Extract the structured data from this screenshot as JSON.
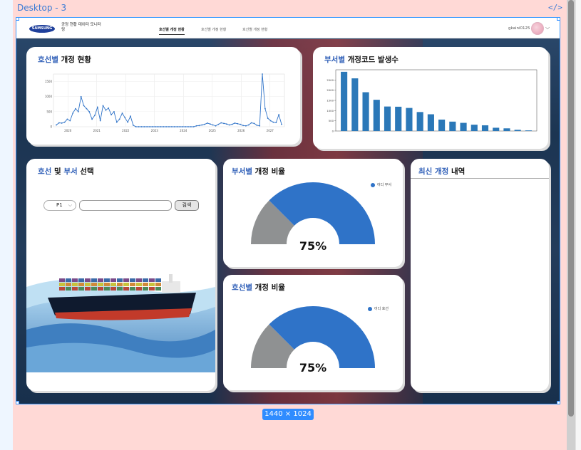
{
  "canvas": {
    "frame_label": "Desktop - 3",
    "code_icon": "</>",
    "size_badge": "1440 × 1024"
  },
  "header": {
    "logo_text": "SAMSUNG",
    "app_name": "공정 현황 데이터 모니터링",
    "nav": [
      "호선별 개정 현황",
      "호선별 개정 현황",
      "호선별 개정 현황"
    ],
    "user": "gkaini0125"
  },
  "cards": {
    "ship_revision": {
      "title_accent": "호선별",
      "title_rest": " 개정 현황"
    },
    "dept_code": {
      "title_accent": "부서별",
      "title_rest": " 개정코드 발생수"
    },
    "selector": {
      "title_a1": "호선",
      "title_mid": " 및 ",
      "title_a2": "부서",
      "title_rest": " 선택",
      "select_value": "P1",
      "search_label": "검색"
    },
    "dept_ratio": {
      "title_accent": "부서별",
      "title_rest": " 개정 비율",
      "legend": "어디 부서",
      "percent": "75%"
    },
    "ship_ratio": {
      "title_accent": "호선별",
      "title_rest": " 개정 비율",
      "legend": "어디 호선",
      "percent": "75%"
    },
    "recent": {
      "title_accent": "최신 개정",
      "title_rest": " 내역"
    }
  },
  "colors": {
    "accent": "#2f5fb8",
    "series": "#2f73c8",
    "gauge_gray": "#8f9192",
    "bar": "#2b78b8"
  },
  "chart_data": [
    {
      "type": "line",
      "name": "ship-revision-timeline",
      "x_ticks": [
        "2020",
        "2021",
        "2022",
        "2023",
        "2024",
        "2025",
        "2026",
        "2027"
      ],
      "ylim": [
        0,
        1750
      ],
      "y_ticks": [
        0,
        500,
        1000,
        1500
      ],
      "values": [
        60,
        130,
        120,
        150,
        250,
        200,
        450,
        600,
        500,
        1000,
        700,
        600,
        500,
        250,
        380,
        650,
        200,
        700,
        550,
        620,
        400,
        500,
        150,
        250,
        450,
        300,
        150,
        350,
        50,
        0,
        0,
        0,
        0,
        0,
        0,
        0,
        0,
        0,
        0,
        0,
        0,
        0,
        0,
        0,
        0,
        0,
        0,
        0,
        0,
        0,
        0,
        30,
        40,
        60,
        80,
        120,
        90,
        60,
        30,
        80,
        130,
        110,
        90,
        60,
        80,
        120,
        100,
        80,
        40,
        30,
        60,
        130,
        110,
        50,
        30,
        1750,
        600,
        280,
        200,
        150,
        140,
        400,
        80
      ]
    },
    {
      "type": "bar",
      "name": "dept-code-counts",
      "ylim": [
        0,
        3000
      ],
      "y_ticks": [
        0,
        500,
        1000,
        1500,
        2000,
        2500
      ],
      "values": [
        2900,
        2580,
        1900,
        1530,
        1200,
        1190,
        1130,
        930,
        820,
        560,
        460,
        400,
        310,
        280,
        160,
        130,
        60,
        30
      ]
    },
    {
      "type": "pie",
      "name": "dept-ratio-gauge",
      "value": 0.75
    },
    {
      "type": "pie",
      "name": "ship-ratio-gauge",
      "value": 0.75
    }
  ]
}
